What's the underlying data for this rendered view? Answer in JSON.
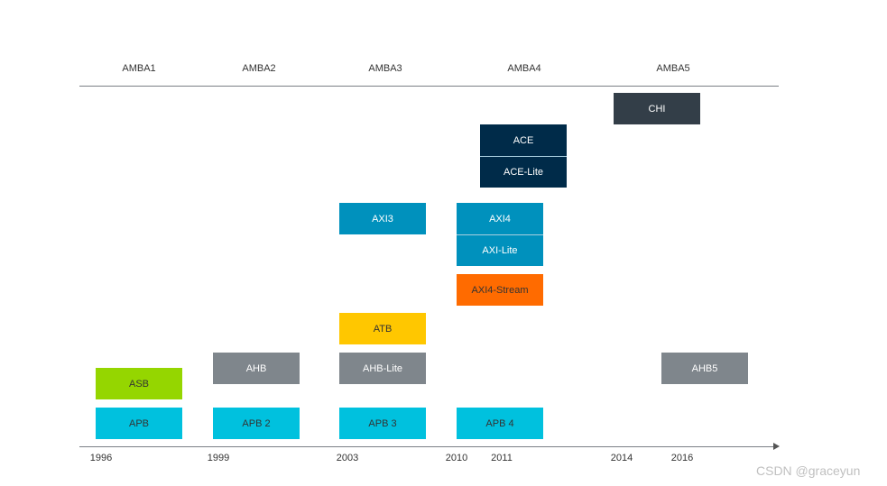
{
  "generations": [
    "AMBA1",
    "AMBA2",
    "AMBA3",
    "AMBA4",
    "AMBA5"
  ],
  "years": [
    "1996",
    "1999",
    "2003",
    "2010",
    "2011",
    "2014",
    "2016"
  ],
  "boxes": {
    "asb": {
      "label": "ASB",
      "color": "#95d600"
    },
    "apb": {
      "label": "APB",
      "color": "#00c1de"
    },
    "ahb": {
      "label": "AHB",
      "color": "#7f868c"
    },
    "apb2": {
      "label": "APB 2",
      "color": "#00c1de"
    },
    "ahb_lite": {
      "label": "AHB-Lite",
      "color": "#7f868c"
    },
    "atb": {
      "label": "ATB",
      "color": "#ffc700"
    },
    "apb3": {
      "label": "APB 3",
      "color": "#00c1de"
    },
    "axi3": {
      "label": "AXI3",
      "color": "#0091bd"
    },
    "axi4": {
      "label": "AXI4",
      "color": "#0091bd"
    },
    "axi_lite": {
      "label": "AXI-Lite",
      "color": "#0091bd"
    },
    "axi4_stream": {
      "label": "AXI4-Stream",
      "color": "#ff6b00"
    },
    "apb4": {
      "label": "APB 4",
      "color": "#00c1de"
    },
    "ace": {
      "label": "ACE",
      "color": "#002b49"
    },
    "ace_lite": {
      "label": "ACE-Lite",
      "color": "#002b49"
    },
    "chi": {
      "label": "CHI",
      "color": "#333e48"
    },
    "ahb5": {
      "label": "AHB5",
      "color": "#7f868c"
    }
  },
  "watermark": "CSDN @graceyun"
}
